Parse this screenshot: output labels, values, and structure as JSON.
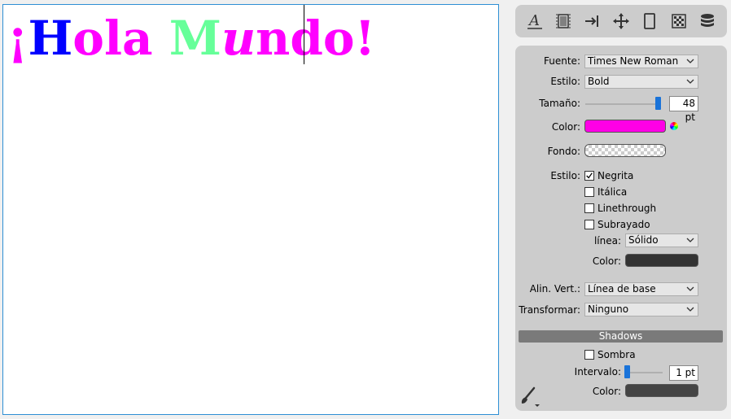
{
  "canvas": {
    "text_parts": [
      {
        "text": "¡",
        "color": "#ff00ff",
        "italic": false
      },
      {
        "text": "H",
        "color": "#0000ff",
        "italic": false
      },
      {
        "text": "ola ",
        "color": "#ff00ff",
        "italic": false
      },
      {
        "text": "M",
        "color": "#66ff99",
        "italic": false
      },
      {
        "text": "u",
        "color": "#ff00ff",
        "italic": true
      },
      {
        "text": "ndo",
        "color": "#ff00ff",
        "italic": false
      },
      {
        "text": "!",
        "color": "#ff00ff",
        "italic": false
      }
    ]
  },
  "toolbar": {
    "icons": [
      "text-style-icon",
      "frame-icon",
      "indent-icon",
      "move-icon",
      "rectangle-icon",
      "pattern-icon",
      "database-icon"
    ]
  },
  "panel": {
    "font_label": "Fuente:",
    "font_value": "Times New Roman",
    "style_label": "Estilo:",
    "style_value": "Bold",
    "size_label": "Tamaño:",
    "size_value": "48 pt",
    "size_level": 1.0,
    "color_label": "Color:",
    "color_value": "#ff00e6",
    "background_label": "Fondo:",
    "style_checks_label": "Estilo:",
    "checks": [
      {
        "label": "Negrita",
        "checked": true
      },
      {
        "label": "Itálica",
        "checked": false
      },
      {
        "label": "Linethrough",
        "checked": false
      },
      {
        "label": "Subrayado",
        "checked": false
      }
    ],
    "line_label": "línea:",
    "line_value": "Sólido",
    "line_color_label": "Color:",
    "line_color_value": "#333333",
    "valign_label": "Alin. Vert.:",
    "valign_value": "Línea de base",
    "transform_label": "Transformar:",
    "transform_value": "Ninguno"
  },
  "shadows": {
    "header": "Shadows",
    "shadow_label": "Sombra",
    "shadow_checked": false,
    "interval_label": "Intervalo:",
    "interval_value": "1 pt",
    "interval_level": 0.0,
    "color_label": "Color:",
    "color_value": "#444444"
  }
}
